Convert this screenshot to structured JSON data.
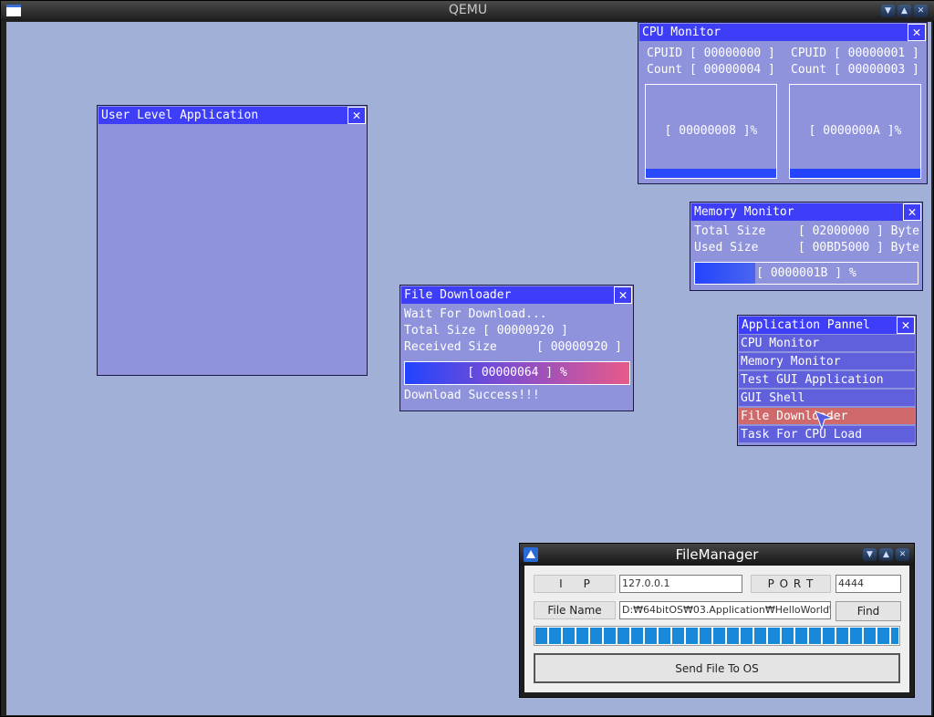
{
  "host": {
    "title": "QEMU"
  },
  "user_app": {
    "title": "User Level Application"
  },
  "cpu_monitor": {
    "title": "CPU Monitor",
    "cores": [
      {
        "cpuid": "CPUID [ 00000000 ]",
        "count": "Count [ 00000004 ]",
        "load_label": "[ 00000008 ]%",
        "load": 0.08
      },
      {
        "cpuid": "CPUID [ 00000001 ]",
        "count": "Count [ 00000003 ]",
        "load_label": "[ 0000000A ]%",
        "load": 0.1
      }
    ]
  },
  "memory_monitor": {
    "title": "Memory Monitor",
    "total_label": "Total Size",
    "total_value": "[ 02000000 ] Byte",
    "used_label": "Used Size",
    "used_value": "[ 00BD5000 ] Byte",
    "usage_label": "[ 0000001B ] %",
    "usage": 0.27
  },
  "file_downloader": {
    "title": "File Downloader",
    "status": "Wait For Download...",
    "total_size": "Total Size [ 00000920 ]",
    "received_label": "Received Size",
    "received_value": "[ 00000920 ]",
    "progress_label": "[ 00000064 ] %",
    "progress": 1.0,
    "result": "Download Success!!!"
  },
  "app_panel": {
    "title": "Application Pannel",
    "items": [
      {
        "label": "CPU Monitor",
        "active": false
      },
      {
        "label": "Memory Monitor",
        "active": false
      },
      {
        "label": "Test GUI Application",
        "active": false
      },
      {
        "label": "GUI Shell",
        "active": false
      },
      {
        "label": "File Downloader",
        "active": true
      },
      {
        "label": "Task For CPU Load",
        "active": false
      }
    ]
  },
  "file_manager": {
    "title": "FileManager",
    "ip_label": "I      P",
    "ip_value": "127.0.0.1",
    "port_label": "P O R T",
    "port_value": "4444",
    "filename_label": "File Name",
    "filename_value": "D:₩64bitOS₩03.Application₩HelloWorld₩",
    "find_label": "Find",
    "progress": 1.0,
    "send_label": "Send File To OS"
  },
  "colors": {
    "desktop": "#a0b0d6",
    "window_body": "#8e93dc",
    "title_bar": "#3e3ef8",
    "menu_item": "#6060dc",
    "menu_active": "#d06a6a",
    "bar_blue": "#2244ff",
    "bar_pink": "#e85a8a",
    "fm_progress": "#1888d8"
  },
  "icons": [
    "close-icon",
    "minimize-icon",
    "maximize-icon",
    "app-icon",
    "cursor-icon"
  ]
}
